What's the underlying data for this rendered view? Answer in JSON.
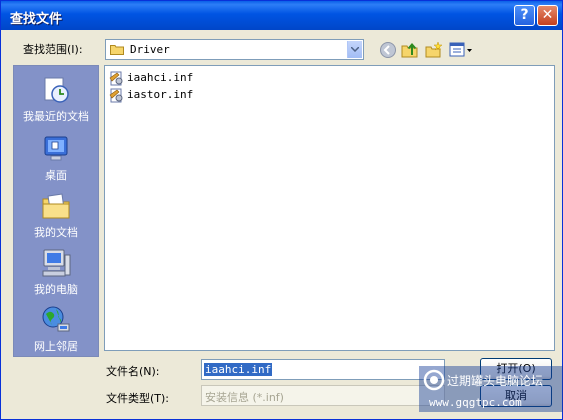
{
  "window": {
    "title": "查找文件",
    "help_glyph": "?",
    "close_glyph": "✕"
  },
  "lookin": {
    "label": "查找范围(I):",
    "value": "Driver"
  },
  "toolbar": {
    "icons": [
      "back-icon",
      "up-folder-icon",
      "new-folder-icon",
      "views-menu-icon"
    ]
  },
  "places": [
    {
      "label": "我最近的文档",
      "icon": "recent-documents-icon"
    },
    {
      "label": "桌面",
      "icon": "desktop-icon"
    },
    {
      "label": "我的文档",
      "icon": "my-documents-icon"
    },
    {
      "label": "我的电脑",
      "icon": "my-computer-icon"
    },
    {
      "label": "网上邻居",
      "icon": "network-places-icon"
    }
  ],
  "files": [
    {
      "name": "iaahci.inf",
      "icon": "inf-file-icon"
    },
    {
      "name": "iastor.inf",
      "icon": "inf-file-icon"
    }
  ],
  "filename": {
    "label": "文件名(N):",
    "value": "iaahci.inf"
  },
  "filetype": {
    "label": "文件类型(T):",
    "value": "安装信息 (*.inf)"
  },
  "buttons": {
    "open": "打开(O)",
    "cancel": "取消"
  },
  "watermark": {
    "line1": "过期罐头电脑论坛",
    "line2": "www.gqgtpc.com"
  },
  "colors": {
    "titlebar": "#0054e3",
    "places_bar": "#8392c8",
    "dialog_bg": "#ece9d8",
    "selection": "#316ac5"
  }
}
